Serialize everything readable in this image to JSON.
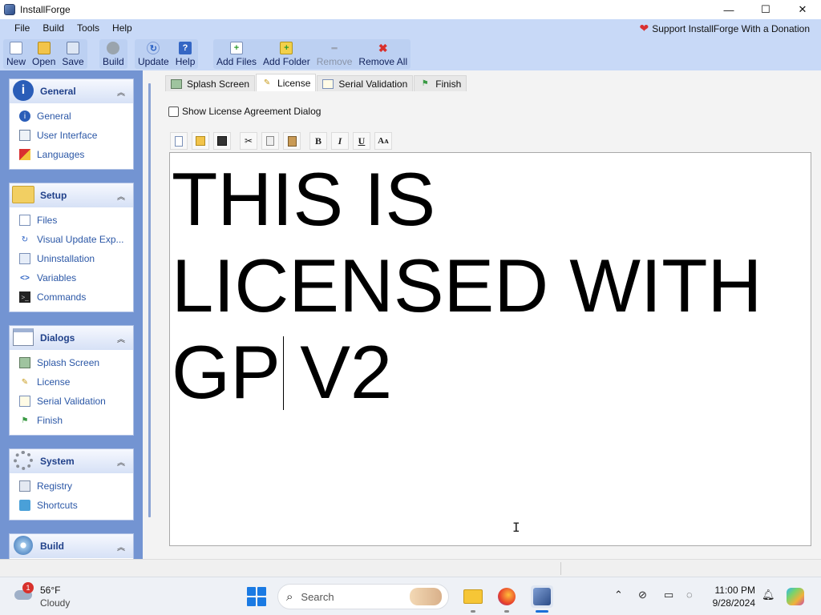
{
  "window": {
    "title": "InstallForge",
    "controls": [
      "—",
      "☐",
      "✕"
    ]
  },
  "menu": {
    "items": [
      "File",
      "Build",
      "Tools",
      "Help"
    ],
    "donate": "Support InstallForge With a Donation"
  },
  "toolbar": {
    "group1": [
      "New",
      "Open",
      "Save"
    ],
    "group2": [
      "Build"
    ],
    "group3": [
      "Update",
      "Help"
    ],
    "group4": [
      "Add Files",
      "Add Folder",
      "Remove",
      "Remove All"
    ]
  },
  "sidebar": {
    "general": {
      "title": "General",
      "items": [
        "General",
        "User Interface",
        "Languages"
      ]
    },
    "setup": {
      "title": "Setup",
      "items": [
        "Files",
        "Visual Update Exp...",
        "Uninstallation",
        "Variables",
        "Commands"
      ]
    },
    "dialogs": {
      "title": "Dialogs",
      "items": [
        "Splash Screen",
        "License",
        "Serial Validation",
        "Finish"
      ]
    },
    "system": {
      "title": "System",
      "items": [
        "Registry",
        "Shortcuts"
      ]
    },
    "build": {
      "title": "Build"
    }
  },
  "tabs": [
    "Splash Screen",
    "License",
    "Serial Validation",
    "Finish"
  ],
  "active_tab": "License",
  "license": {
    "checkbox_label": "Show License Agreement Dialog",
    "checked": false,
    "line1": "THIS IS",
    "line2": "LICENSED WITH",
    "line3": "GP V2"
  },
  "taskbar": {
    "weather_temp": "56°F",
    "weather_cond": "Cloudy",
    "weather_badge": "1",
    "search_label": "Search",
    "time": "11:00 PM",
    "date": "9/28/2024"
  },
  "colors": {
    "menubar": "#c8d9f7",
    "sidebar": "#7394d2",
    "panel_title": "#21418a",
    "link": "#2b57a6"
  }
}
